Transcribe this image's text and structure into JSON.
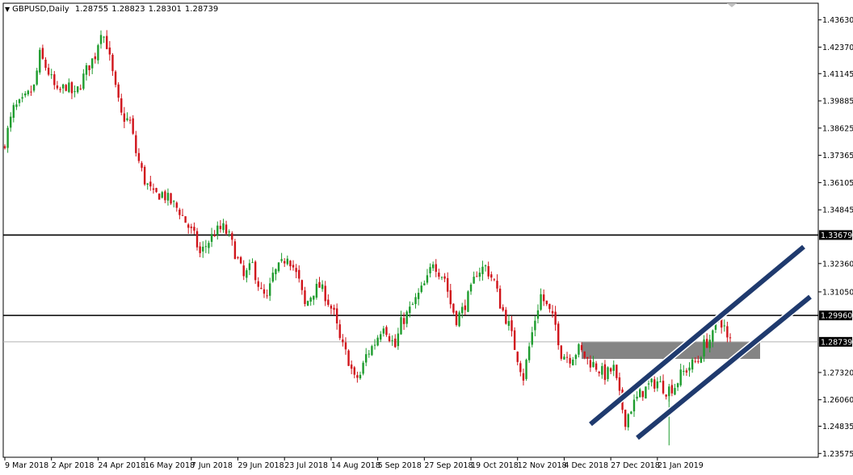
{
  "header": {
    "symbol_timeframe": "GBPUSD,Daily",
    "ohlc": [
      "1.28755",
      "1.28823",
      "1.28301",
      "1.28739"
    ]
  },
  "chart_data": {
    "type": "candlestick",
    "title": "GBPUSD,Daily",
    "ylim": [
      1.234,
      1.444
    ],
    "y_ticks": [
      "1.43630",
      "1.42370",
      "1.41145",
      "1.39885",
      "1.38625",
      "1.37365",
      "1.36105",
      "1.34845",
      "1.32360",
      "1.31050",
      "1.27320",
      "1.26060",
      "1.24835",
      "1.23575"
    ],
    "x_ticks": [
      "9 Mar 2018",
      "2 Apr 2018",
      "24 Apr 2018",
      "16 May 2018",
      "7 Jun 2018",
      "29 Jun 2018",
      "23 Jul 2018",
      "14 Aug 2018",
      "5 Sep 2018",
      "27 Sep 2018",
      "19 Oct 2018",
      "12 Nov 2018",
      "4 Dec 2018",
      "27 Dec 2018",
      "21 Jan 2019"
    ],
    "horizontal_levels": [
      {
        "label": "1.33679",
        "value": 1.33679
      },
      {
        "label": "1.29960",
        "value": 1.2996
      }
    ],
    "current_price": {
      "label": "1.28739",
      "value": 1.28739
    },
    "close_path": [
      [
        0,
        1.38
      ],
      [
        3,
        1.395
      ],
      [
        6,
        1.398
      ],
      [
        10,
        1.405
      ],
      [
        12,
        1.42
      ],
      [
        15,
        1.412
      ],
      [
        18,
        1.402
      ],
      [
        21,
        1.406
      ],
      [
        24,
        1.401
      ],
      [
        28,
        1.413
      ],
      [
        31,
        1.42
      ],
      [
        33,
        1.432
      ],
      [
        35,
        1.425
      ],
      [
        38,
        1.404
      ],
      [
        40,
        1.392
      ],
      [
        43,
        1.389
      ],
      [
        45,
        1.375
      ],
      [
        48,
        1.362
      ],
      [
        51,
        1.355
      ],
      [
        54,
        1.356
      ],
      [
        57,
        1.352
      ],
      [
        60,
        1.348
      ],
      [
        62,
        1.343
      ],
      [
        65,
        1.336
      ],
      [
        67,
        1.328
      ],
      [
        70,
        1.334
      ],
      [
        72,
        1.338
      ],
      [
        75,
        1.34
      ],
      [
        77,
        1.336
      ],
      [
        80,
        1.325
      ],
      [
        82,
        1.317
      ],
      [
        85,
        1.323
      ],
      [
        88,
        1.31
      ],
      [
        90,
        1.307
      ],
      [
        92,
        1.318
      ],
      [
        95,
        1.323
      ],
      [
        97,
        1.328
      ],
      [
        99,
        1.322
      ],
      [
        101,
        1.315
      ],
      [
        103,
        1.304
      ],
      [
        106,
        1.311
      ],
      [
        108,
        1.313
      ],
      [
        110,
        1.309
      ],
      [
        113,
        1.3
      ],
      [
        115,
        1.288
      ],
      [
        118,
        1.279
      ],
      [
        120,
        1.27
      ],
      [
        122,
        1.272
      ],
      [
        124,
        1.281
      ],
      [
        127,
        1.287
      ],
      [
        130,
        1.296
      ],
      [
        132,
        1.29
      ],
      [
        134,
        1.285
      ],
      [
        136,
        1.296
      ],
      [
        139,
        1.302
      ],
      [
        142,
        1.309
      ],
      [
        145,
        1.316
      ],
      [
        147,
        1.325
      ],
      [
        149,
        1.32
      ],
      [
        151,
        1.317
      ],
      [
        153,
        1.305
      ],
      [
        155,
        1.298
      ],
      [
        157,
        1.302
      ],
      [
        160,
        1.311
      ],
      [
        162,
        1.32
      ],
      [
        165,
        1.322
      ],
      [
        168,
        1.315
      ],
      [
        170,
        1.305
      ],
      [
        173,
        1.295
      ],
      [
        175,
        1.285
      ],
      [
        178,
        1.271
      ],
      [
        180,
        1.285
      ],
      [
        182,
        1.298
      ],
      [
        184,
        1.309
      ],
      [
        187,
        1.301
      ],
      [
        189,
        1.295
      ],
      [
        191,
        1.282
      ],
      [
        194,
        1.28
      ],
      [
        197,
        1.284
      ],
      [
        200,
        1.279
      ],
      [
        203,
        1.276
      ],
      [
        206,
        1.272
      ],
      [
        209,
        1.275
      ],
      [
        211,
        1.262
      ],
      [
        213,
        1.251
      ],
      [
        215,
        1.257
      ],
      [
        218,
        1.263
      ],
      [
        221,
        1.267
      ],
      [
        224,
        1.269
      ],
      [
        227,
        1.265
      ],
      [
        230,
        1.267
      ],
      [
        232,
        1.272
      ],
      [
        235,
        1.276
      ],
      [
        238,
        1.279
      ],
      [
        240,
        1.286
      ],
      [
        243,
        1.29
      ],
      [
        245,
        1.299
      ],
      [
        247,
        1.294
      ],
      [
        248,
        1.288
      ]
    ],
    "grid": false,
    "annotations": [
      "support-resistance zone",
      "ascending channel upper line",
      "ascending channel lower line"
    ]
  },
  "colors": {
    "background": "#ffffff",
    "bull": "#1e9c2e",
    "bear": "#d0141b",
    "level_line": "#000000",
    "channel": "#1f3a6e",
    "zone": "#6e6e6e",
    "axis_text": "#000000"
  }
}
